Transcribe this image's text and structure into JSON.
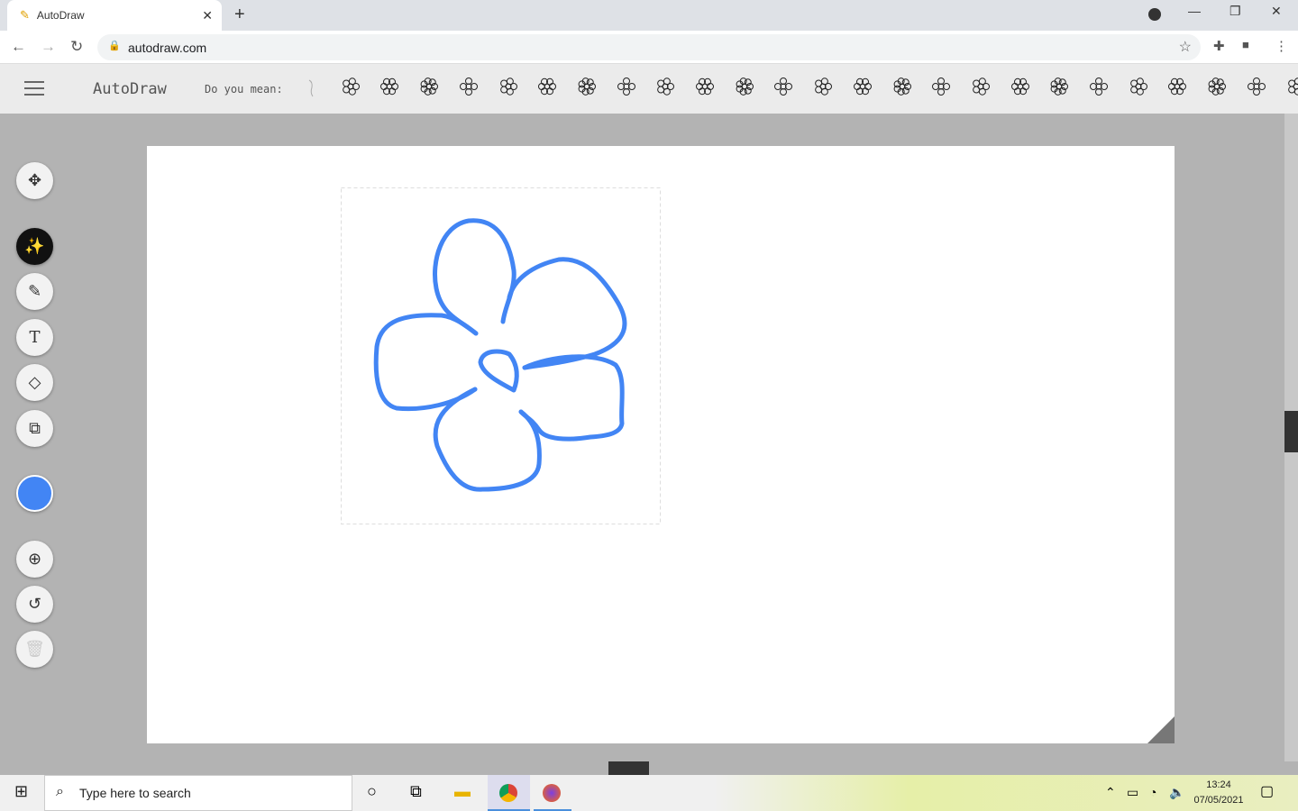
{
  "browser": {
    "tab_title": "AutoDraw",
    "url": "autodraw.com"
  },
  "app": {
    "logo": "AutoDraw",
    "suggest_label": "Do you mean:",
    "suggestions": [
      "doodle",
      "flower",
      "flower-2",
      "flower-3",
      "plant",
      "cross",
      "tripod",
      "ornament",
      "fan",
      "tree",
      "oval",
      "pineapple",
      "grapes",
      "cherry",
      "cherries",
      "key",
      "flower-4",
      "flower-5",
      "bee",
      "frame",
      "door",
      "brush",
      "flower-6",
      "flower-7",
      "clover",
      "hand"
    ],
    "tools": [
      "move",
      "autodraw",
      "draw",
      "type",
      "fill",
      "shape",
      "color",
      "zoom",
      "undo",
      "delete"
    ],
    "colors": {
      "stroke": "#4285f4",
      "selected_color": "#4285f4"
    }
  },
  "taskbar": {
    "search_placeholder": "Type here to search",
    "time": "13:24",
    "date": "07/05/2021"
  }
}
